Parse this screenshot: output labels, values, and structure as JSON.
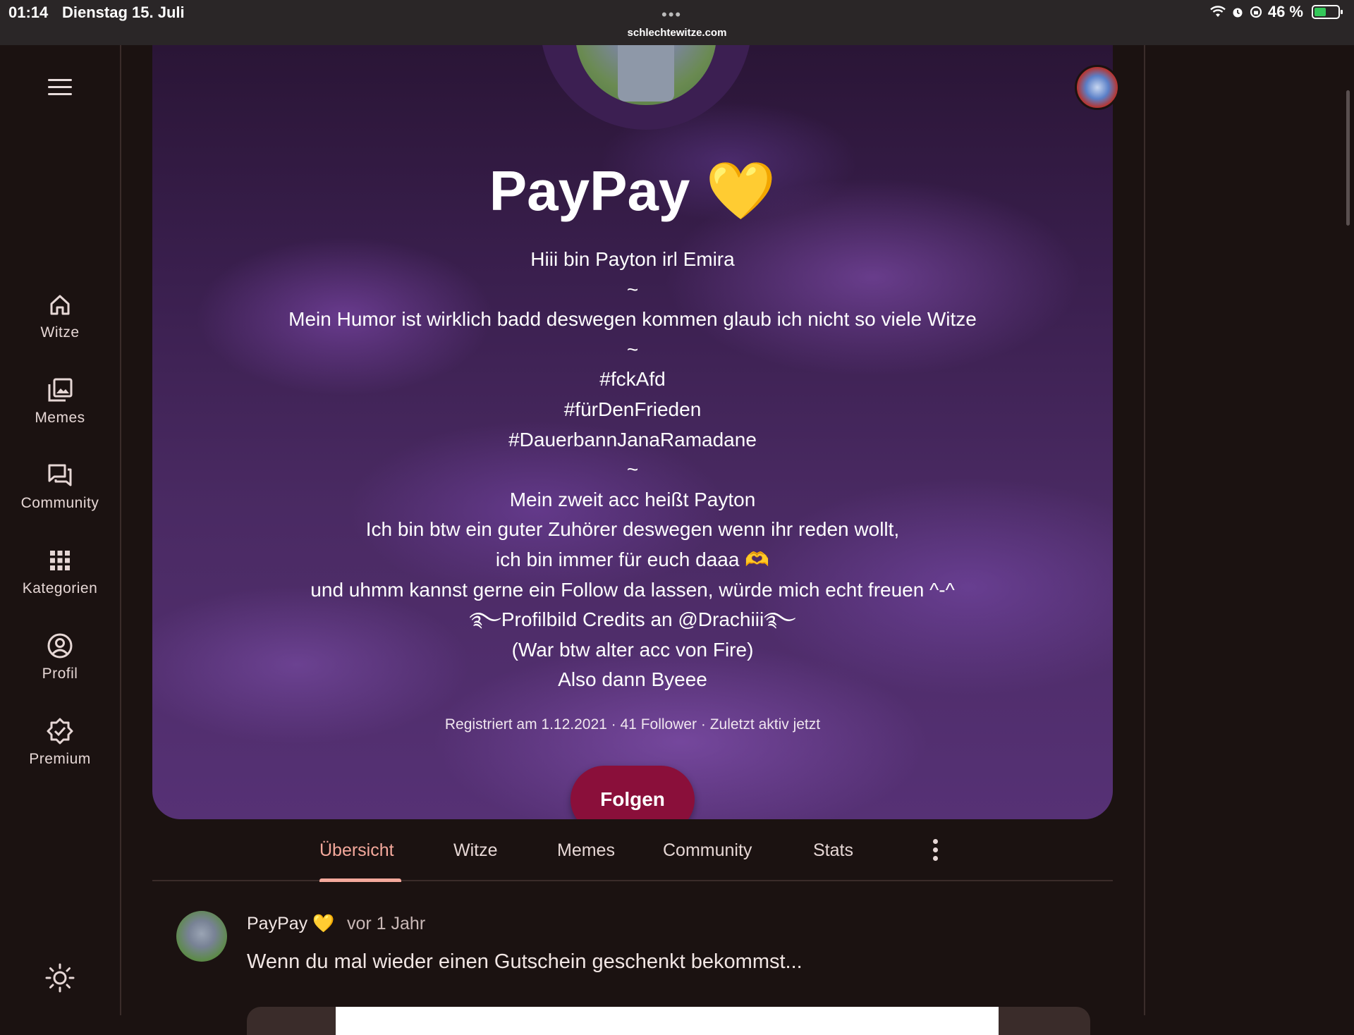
{
  "status_bar": {
    "time": "01:14",
    "date": "Dienstag 15. Juli",
    "url": "schlechtewitze.com",
    "battery": "46 %"
  },
  "sidebar": {
    "items": [
      {
        "label": "Witze",
        "icon": "home-icon"
      },
      {
        "label": "Memes",
        "icon": "images-icon"
      },
      {
        "label": "Community",
        "icon": "forum-icon"
      },
      {
        "label": "Kategorien",
        "icon": "grid-icon"
      },
      {
        "label": "Profil",
        "icon": "account-icon"
      },
      {
        "label": "Premium",
        "icon": "verified-badge-icon"
      }
    ]
  },
  "profile": {
    "name": "PayPay 💛",
    "bio": [
      "Hiii bin Payton irl Emira",
      "~",
      "Mein Humor ist wirklich badd deswegen kommen glaub ich nicht so viele Witze",
      "~",
      "#fckAfd",
      "#fürDenFrieden",
      "#DauerbannJanaRamadane",
      "~",
      "Mein zweit acc heißt Payton",
      "Ich bin btw ein guter Zuhörer deswegen wenn ihr reden wollt,",
      "ich bin immer für euch daaa 🫶",
      "und uhmm kannst gerne ein Follow da lassen, würde mich echt freuen ^-^",
      "࿐Profilbild Credits an @Drachiii࿐",
      "(War btw alter acc von Fire)",
      "Also dann Byeee"
    ],
    "meta": "Registriert am 1.12.2021 · 41 Follower · Zuletzt aktiv jetzt",
    "follow_label": "Folgen"
  },
  "tabs": [
    {
      "label": "Übersicht",
      "active": true
    },
    {
      "label": "Witze",
      "active": false
    },
    {
      "label": "Memes",
      "active": false
    },
    {
      "label": "Community",
      "active": false
    },
    {
      "label": "Stats",
      "active": false
    }
  ],
  "post": {
    "author": "PayPay 💛",
    "time": "vor 1 Jahr",
    "text": "Wenn du mal wieder einen Gutschein geschenkt bekommst..."
  },
  "colors": {
    "background": "#1b1211",
    "accent": "#f4a99c",
    "follow_button": "#8a0f3a"
  }
}
